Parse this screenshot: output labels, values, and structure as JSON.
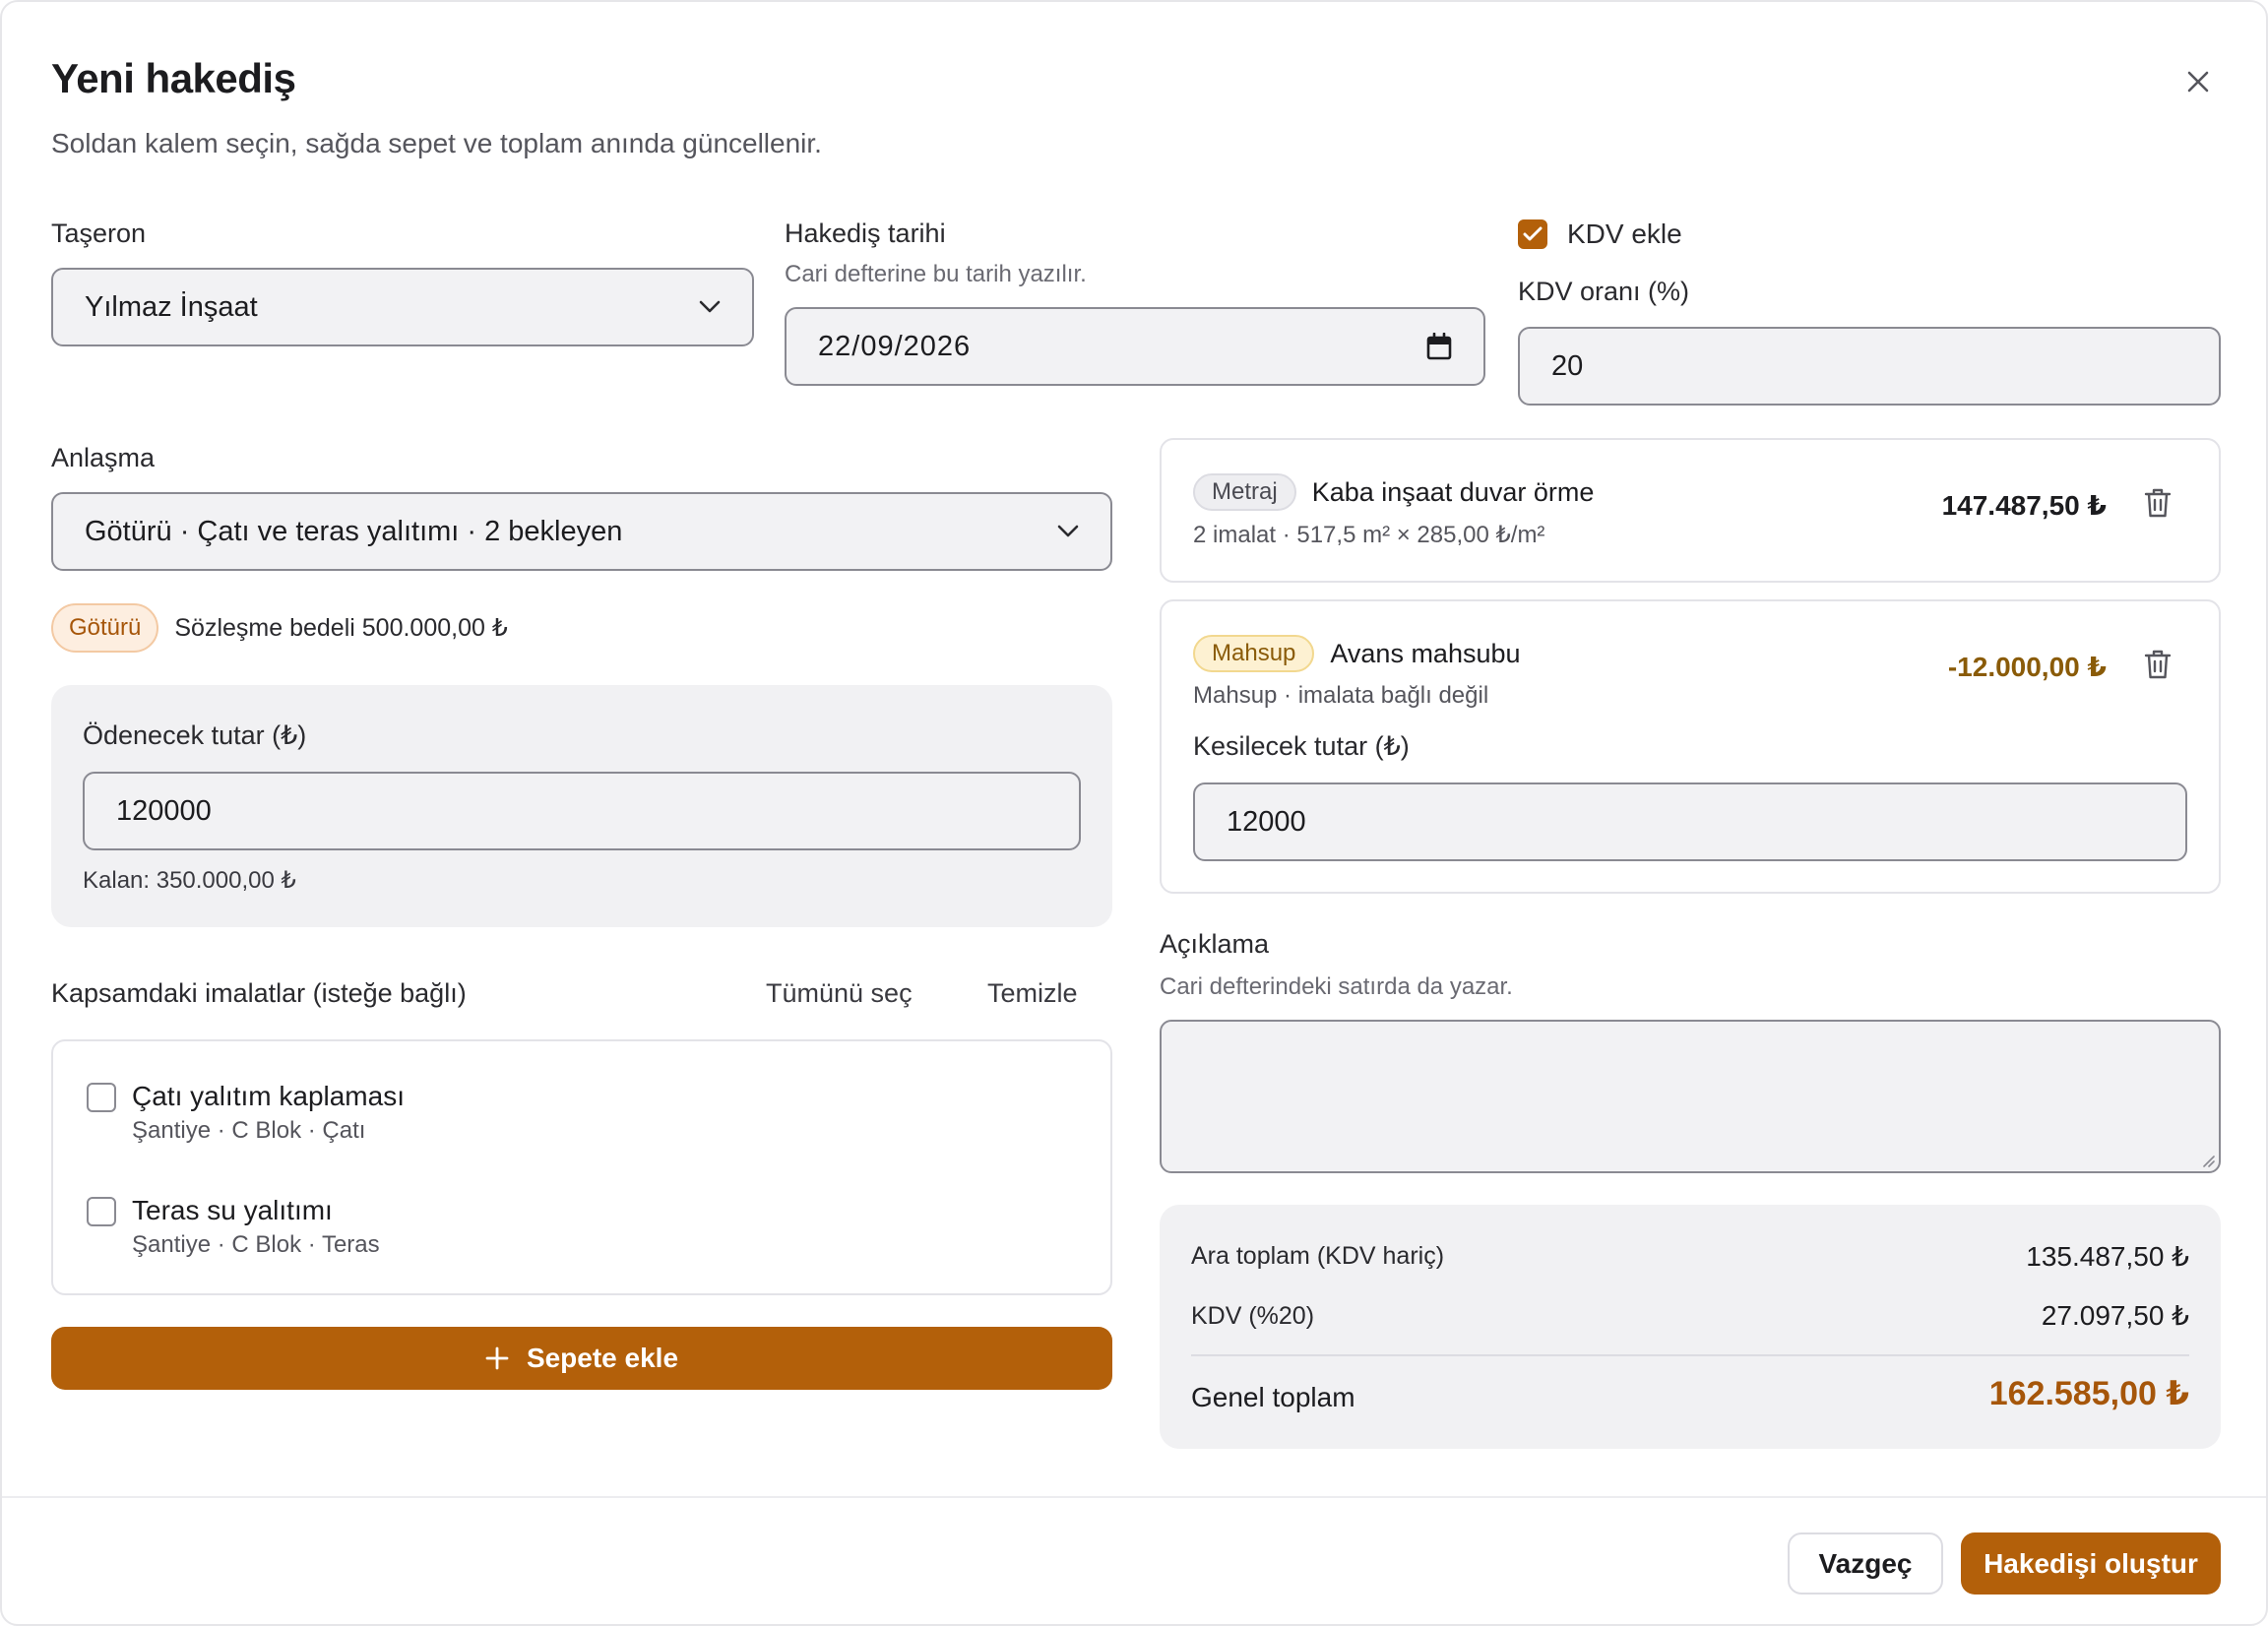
{
  "dialog": {
    "title": "Yeni hakediş",
    "subtitle": "Soldan kalem seçin, sağda sepet ve toplam anında güncellenir."
  },
  "taseron": {
    "label": "Taşeron",
    "value": "Yılmaz İnşaat"
  },
  "tarih": {
    "label": "Hakediş tarihi",
    "hint": "Cari defterine bu tarih yazılır.",
    "value": "22/09/2026"
  },
  "kdv": {
    "checkbox_label": "KDV ekle",
    "checked": true,
    "rate_label": "KDV oranı (%)",
    "rate_value": "20"
  },
  "anlasma": {
    "label": "Anlaşma",
    "value": "Götürü · Çatı ve teras yalıtımı · 2 bekleyen",
    "badge": "Götürü",
    "contract_text": "Sözleşme bedeli 500.000,00 ₺"
  },
  "odenecek": {
    "label": "Ödenecek tutar (₺)",
    "value": "120000",
    "remaining": "Kalan: 350.000,00 ₺"
  },
  "imalatlar": {
    "title": "Kapsamdaki imalatlar (isteğe bağlı)",
    "select_all": "Tümünü seç",
    "clear": "Temizle",
    "items": [
      {
        "name": "Çatı yalıtım kaplaması",
        "location": "Şantiye · C Blok · Çatı",
        "checked": false
      },
      {
        "name": "Teras su yalıtımı",
        "location": "Şantiye · C Blok · Teras",
        "checked": false
      }
    ]
  },
  "add_to_cart": {
    "icon": "plus-icon",
    "label": "Sepete ekle"
  },
  "cart": [
    {
      "badge": "Metraj",
      "title": "Kaba inşaat duvar örme",
      "detail": "2 imalat · 517,5 m² × 285,00 ₺/m²",
      "amount": "147.487,50 ₺"
    },
    {
      "badge": "Mahsup",
      "title": "Avans mahsubu",
      "detail": "Mahsup · imalata bağlı değil",
      "amount": "-12.000,00 ₺",
      "cut_label": "Kesilecek tutar (₺)",
      "cut_value": "12000"
    }
  ],
  "aciklama": {
    "label": "Açıklama",
    "hint": "Cari defterindeki satırda da yazar.",
    "value": ""
  },
  "totals": {
    "subtotal_label": "Ara toplam (KDV hariç)",
    "subtotal": "135.487,50 ₺",
    "kdv_label": "KDV (%20)",
    "kdv": "27.097,50 ₺",
    "grand_label": "Genel toplam",
    "grand": "162.585,00 ₺"
  },
  "footer": {
    "cancel": "Vazgeç",
    "submit": "Hakedişi oluştur"
  },
  "colors": {
    "accent": "#b3600a",
    "negative_amount": "#8a5b08",
    "grand_total": "#a6560a"
  }
}
